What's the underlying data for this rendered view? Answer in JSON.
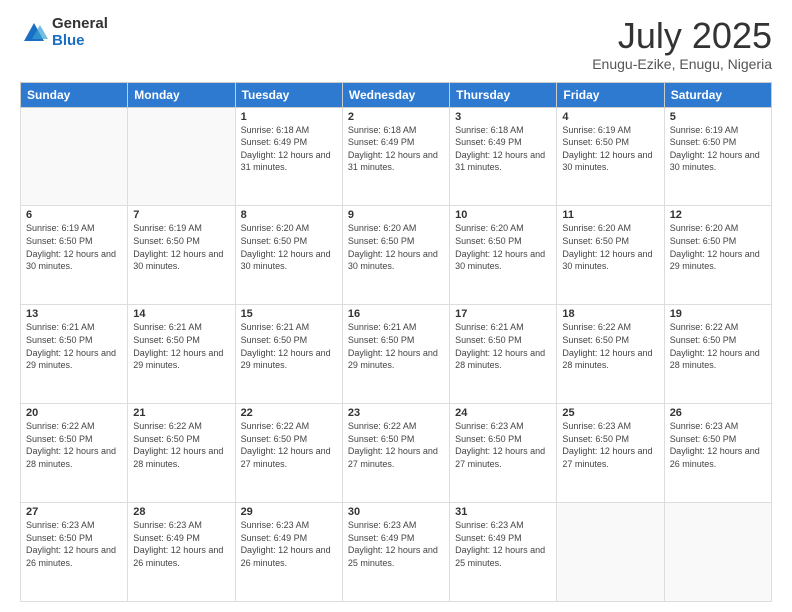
{
  "header": {
    "logo_general": "General",
    "logo_blue": "Blue",
    "title": "July 2025",
    "location": "Enugu-Ezike, Enugu, Nigeria"
  },
  "days_of_week": [
    "Sunday",
    "Monday",
    "Tuesday",
    "Wednesday",
    "Thursday",
    "Friday",
    "Saturday"
  ],
  "weeks": [
    [
      {
        "day": "",
        "detail": ""
      },
      {
        "day": "",
        "detail": ""
      },
      {
        "day": "1",
        "detail": "Sunrise: 6:18 AM\nSunset: 6:49 PM\nDaylight: 12 hours and 31 minutes."
      },
      {
        "day": "2",
        "detail": "Sunrise: 6:18 AM\nSunset: 6:49 PM\nDaylight: 12 hours and 31 minutes."
      },
      {
        "day": "3",
        "detail": "Sunrise: 6:18 AM\nSunset: 6:49 PM\nDaylight: 12 hours and 31 minutes."
      },
      {
        "day": "4",
        "detail": "Sunrise: 6:19 AM\nSunset: 6:50 PM\nDaylight: 12 hours and 30 minutes."
      },
      {
        "day": "5",
        "detail": "Sunrise: 6:19 AM\nSunset: 6:50 PM\nDaylight: 12 hours and 30 minutes."
      }
    ],
    [
      {
        "day": "6",
        "detail": "Sunrise: 6:19 AM\nSunset: 6:50 PM\nDaylight: 12 hours and 30 minutes."
      },
      {
        "day": "7",
        "detail": "Sunrise: 6:19 AM\nSunset: 6:50 PM\nDaylight: 12 hours and 30 minutes."
      },
      {
        "day": "8",
        "detail": "Sunrise: 6:20 AM\nSunset: 6:50 PM\nDaylight: 12 hours and 30 minutes."
      },
      {
        "day": "9",
        "detail": "Sunrise: 6:20 AM\nSunset: 6:50 PM\nDaylight: 12 hours and 30 minutes."
      },
      {
        "day": "10",
        "detail": "Sunrise: 6:20 AM\nSunset: 6:50 PM\nDaylight: 12 hours and 30 minutes."
      },
      {
        "day": "11",
        "detail": "Sunrise: 6:20 AM\nSunset: 6:50 PM\nDaylight: 12 hours and 30 minutes."
      },
      {
        "day": "12",
        "detail": "Sunrise: 6:20 AM\nSunset: 6:50 PM\nDaylight: 12 hours and 29 minutes."
      }
    ],
    [
      {
        "day": "13",
        "detail": "Sunrise: 6:21 AM\nSunset: 6:50 PM\nDaylight: 12 hours and 29 minutes."
      },
      {
        "day": "14",
        "detail": "Sunrise: 6:21 AM\nSunset: 6:50 PM\nDaylight: 12 hours and 29 minutes."
      },
      {
        "day": "15",
        "detail": "Sunrise: 6:21 AM\nSunset: 6:50 PM\nDaylight: 12 hours and 29 minutes."
      },
      {
        "day": "16",
        "detail": "Sunrise: 6:21 AM\nSunset: 6:50 PM\nDaylight: 12 hours and 29 minutes."
      },
      {
        "day": "17",
        "detail": "Sunrise: 6:21 AM\nSunset: 6:50 PM\nDaylight: 12 hours and 28 minutes."
      },
      {
        "day": "18",
        "detail": "Sunrise: 6:22 AM\nSunset: 6:50 PM\nDaylight: 12 hours and 28 minutes."
      },
      {
        "day": "19",
        "detail": "Sunrise: 6:22 AM\nSunset: 6:50 PM\nDaylight: 12 hours and 28 minutes."
      }
    ],
    [
      {
        "day": "20",
        "detail": "Sunrise: 6:22 AM\nSunset: 6:50 PM\nDaylight: 12 hours and 28 minutes."
      },
      {
        "day": "21",
        "detail": "Sunrise: 6:22 AM\nSunset: 6:50 PM\nDaylight: 12 hours and 28 minutes."
      },
      {
        "day": "22",
        "detail": "Sunrise: 6:22 AM\nSunset: 6:50 PM\nDaylight: 12 hours and 27 minutes."
      },
      {
        "day": "23",
        "detail": "Sunrise: 6:22 AM\nSunset: 6:50 PM\nDaylight: 12 hours and 27 minutes."
      },
      {
        "day": "24",
        "detail": "Sunrise: 6:23 AM\nSunset: 6:50 PM\nDaylight: 12 hours and 27 minutes."
      },
      {
        "day": "25",
        "detail": "Sunrise: 6:23 AM\nSunset: 6:50 PM\nDaylight: 12 hours and 27 minutes."
      },
      {
        "day": "26",
        "detail": "Sunrise: 6:23 AM\nSunset: 6:50 PM\nDaylight: 12 hours and 26 minutes."
      }
    ],
    [
      {
        "day": "27",
        "detail": "Sunrise: 6:23 AM\nSunset: 6:50 PM\nDaylight: 12 hours and 26 minutes."
      },
      {
        "day": "28",
        "detail": "Sunrise: 6:23 AM\nSunset: 6:49 PM\nDaylight: 12 hours and 26 minutes."
      },
      {
        "day": "29",
        "detail": "Sunrise: 6:23 AM\nSunset: 6:49 PM\nDaylight: 12 hours and 26 minutes."
      },
      {
        "day": "30",
        "detail": "Sunrise: 6:23 AM\nSunset: 6:49 PM\nDaylight: 12 hours and 25 minutes."
      },
      {
        "day": "31",
        "detail": "Sunrise: 6:23 AM\nSunset: 6:49 PM\nDaylight: 12 hours and 25 minutes."
      },
      {
        "day": "",
        "detail": ""
      },
      {
        "day": "",
        "detail": ""
      }
    ]
  ]
}
